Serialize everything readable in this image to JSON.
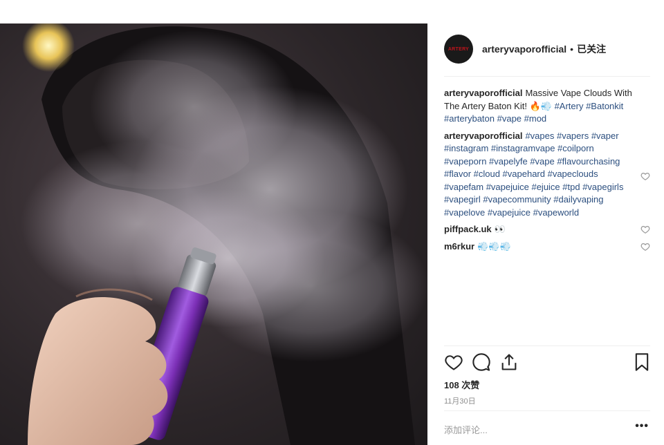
{
  "post": {
    "image_alt": "person exhaling vape cloud holding purple Artery Baton kit",
    "avatar_text": "ARTERY",
    "username": "arteryvaporofficial",
    "separator": "•",
    "follow_state": "已关注",
    "likes": "108 次赞",
    "date": "11月30日",
    "add_comment_placeholder": "添加评论...",
    "more_label": "•••"
  },
  "comments": [
    {
      "user": "arteryvaporofficial",
      "text": "Massive Vape Clouds With The Artery Baton Kit! 🔥💨",
      "tags": "#Artery #Batonkit #arterybaton #vape #mod",
      "has_like": false
    },
    {
      "user": "arteryvaporofficial",
      "text": "",
      "tags": "#vapes #vapers #vaper #instagram #instagramvape #coilporn #vapeporn #vapelyfe #vape #flavourchasing #flavor #cloud #vapehard #vapeclouds #vapefam #vapejuice #ejuice #tpd #vapegirls #vapegirl #vapecommunity #dailyvaping #vapelove #vapejuice #vapeworld",
      "has_like": true
    },
    {
      "user": "piffpack.uk",
      "text": "👀",
      "tags": "",
      "has_like": true
    },
    {
      "user": "m6rkur",
      "text": "💨💨💨",
      "tags": "",
      "has_like": true
    }
  ],
  "icons": {
    "like": "heart-icon",
    "comment": "comment-icon",
    "share": "share-icon",
    "save": "bookmark-icon",
    "comment_like": "heart-small-icon"
  },
  "colors": {
    "hashtag": "#2c4f7f",
    "text": "#262626",
    "muted": "#8e8e8e",
    "device": "#7b2fb5"
  }
}
